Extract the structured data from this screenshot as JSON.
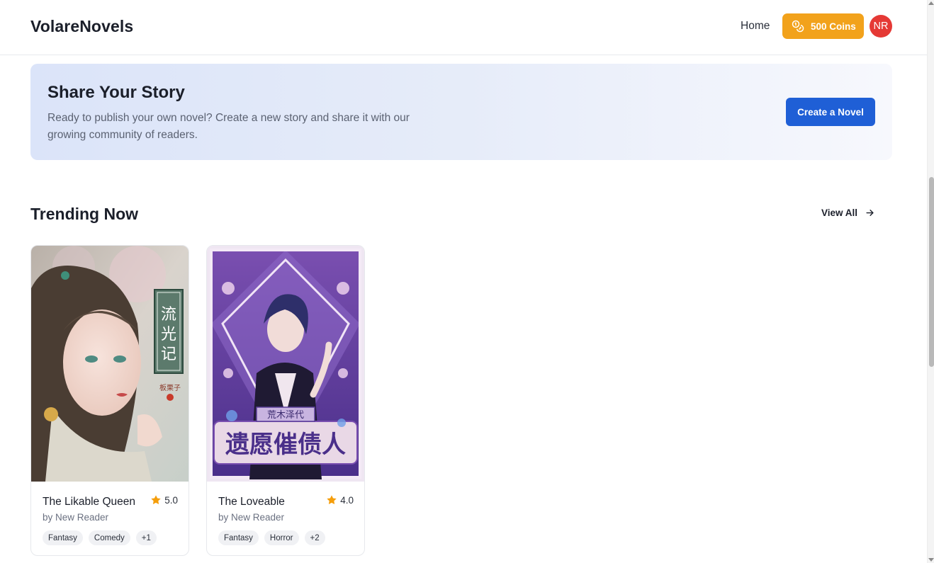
{
  "header": {
    "brand": "VolareNovels",
    "nav_home": "Home",
    "coins_label": "500 Coins",
    "avatar_initials": "NR"
  },
  "banner": {
    "title": "Share Your Story",
    "text": "Ready to publish your own novel? Create a new story and share it with our growing community of readers.",
    "button_label": "Create a Novel"
  },
  "trending": {
    "title": "Trending Now",
    "view_all": "View All",
    "novels": [
      {
        "title": "The Likable Queen",
        "author": "by New Reader",
        "rating": "5.0",
        "tags": [
          "Fantasy",
          "Comedy",
          "+1"
        ],
        "cover_text": "流光记",
        "cover_author": "板栗子"
      },
      {
        "title": "The Loveable",
        "author": "by New Reader",
        "rating": "4.0",
        "tags": [
          "Fantasy",
          "Horror",
          "+2"
        ],
        "cover_text": "遗愿催债人",
        "cover_author": "荒木泽代"
      }
    ]
  },
  "colors": {
    "accent_blue": "#1f5fd6",
    "coins_orange": "#f2a21b",
    "avatar_red": "#e53935",
    "star": "#f59e0b"
  }
}
